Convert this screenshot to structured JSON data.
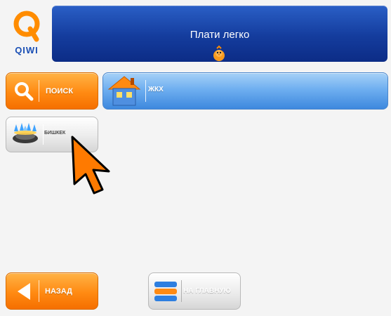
{
  "logo": {
    "text": "QIWI",
    "icon": "qiwi-logo-icon"
  },
  "banner": {
    "title": "Плати легко",
    "icon": "qiwi-bird-mascot-icon"
  },
  "buttons": {
    "search": {
      "label": "ПОИСК",
      "icon": "magnifier-icon"
    },
    "zhkh": {
      "label": "ЖКХ",
      "icon": "house-icon"
    },
    "bishkek": {
      "label": "БИШКЕК",
      "icon": "gas-stove-icon"
    },
    "back": {
      "label": "НАЗАД",
      "icon": "arrow-left-icon"
    },
    "home": {
      "label": "НА ГЛАВНУЮ",
      "icon": "stack-icon"
    }
  },
  "colors": {
    "accent_orange": "#ff8a12",
    "banner_blue": "#143c9d",
    "tile_blue": "#6faff0",
    "logo_blue": "#1a4fb5"
  }
}
